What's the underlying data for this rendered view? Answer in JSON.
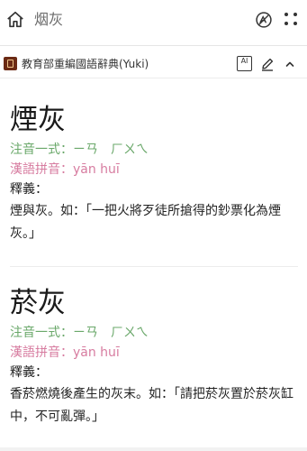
{
  "search": {
    "query": "烟灰"
  },
  "dictionary": {
    "name": "教育部重編國語辭典(Yuki)",
    "ai_label": "AI"
  },
  "entries": [
    {
      "word": "煙灰",
      "zhuyin": "注音一式：ㄧㄢ　ㄏㄨㄟ",
      "pinyin": "漢語拼音：yān huī",
      "definition_label": "釋義：",
      "definition": "煙與灰。如：「一把火將歹徒所搶得的鈔票化為煙灰。」"
    },
    {
      "word": "菸灰",
      "zhuyin": "注音一式：ㄧㄢ　ㄏㄨㄟ",
      "pinyin": "漢語拼音：yān huī",
      "definition_label": "釋義：",
      "definition": "香菸燃燒後產生的灰末。如：「請把菸灰置於菸灰缸中，不可亂彈。」"
    }
  ],
  "colors": {
    "zhuyin": "#6aa86a",
    "pinyin": "#d77ca0",
    "logo": "#6b2a14"
  },
  "icons": [
    "home-icon",
    "translate-icon",
    "grid-icon",
    "ai-icon",
    "edit-icon",
    "collapse-icon",
    "dictionary-logo"
  ]
}
